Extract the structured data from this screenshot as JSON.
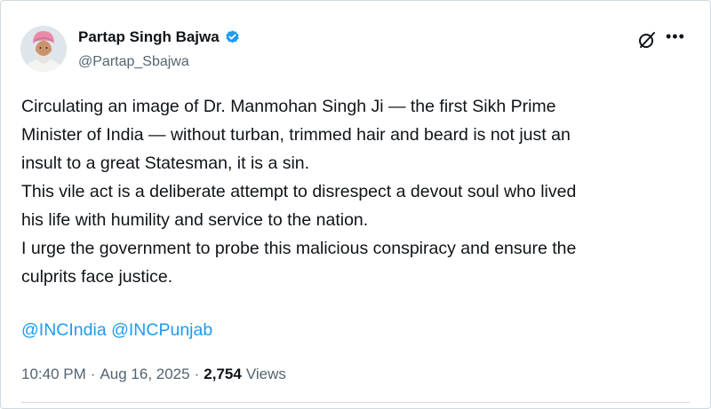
{
  "author": {
    "name": "Partap Singh Bajwa",
    "handle": "@Partap_Sbajwa"
  },
  "tweet": {
    "lines": [
      "Circulating an image of Dr. Manmohan Singh Ji — the first Sikh Prime",
      "Minister of India — without turban, trimmed hair and beard is not just an",
      "insult to a great Statesman, it is a sin.",
      "This vile act is a deliberate attempt to disrespect a devout soul who lived",
      "his life with humility and service to the nation.",
      "I urge the government to probe this malicious conspiracy and ensure the",
      "culprits face justice."
    ],
    "mentions": [
      "@INCIndia",
      "@INCPunjab"
    ]
  },
  "meta": {
    "time": "10:40 PM",
    "dot": "·",
    "date": "Aug 16, 2025",
    "views_count": "2,754",
    "views_label": "Views"
  },
  "colors": {
    "link": "#1d9bf0",
    "verified": "#1d9bf0",
    "secondary_text": "#536471"
  },
  "icons": {
    "verified": "verified-badge-icon",
    "grok": "grok-icon",
    "more": "more-icon"
  }
}
